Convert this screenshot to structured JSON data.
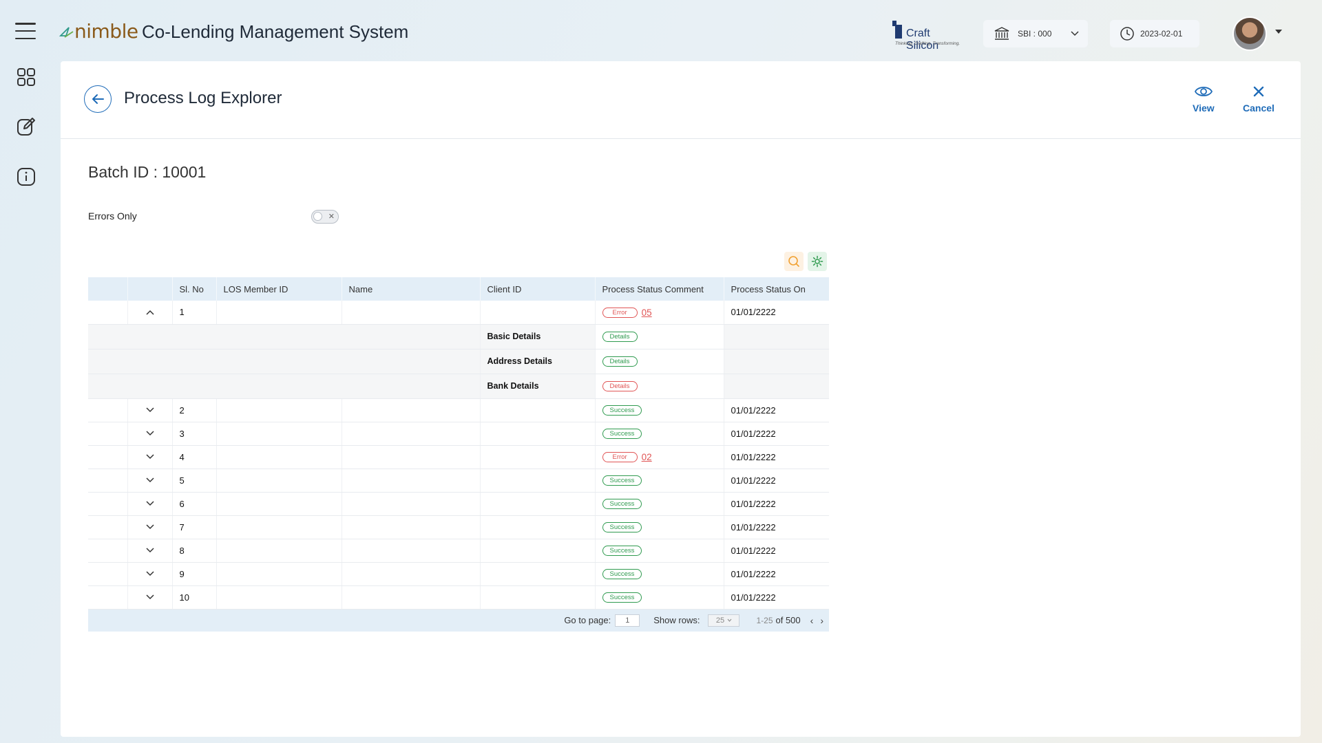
{
  "app": {
    "logo": "nimble",
    "title": "Co-Lending Management System",
    "partner_name": "Craft Silicon",
    "partner_tagline": "Thinking. Crafting. Transforming.",
    "bank_selector": "SBI : 000",
    "date": "2023-02-01"
  },
  "page": {
    "title": "Process Log Explorer",
    "view_label": "View",
    "cancel_label": "Cancel",
    "batch_label": "Batch ID : 10001",
    "errors_only_label": "Errors Only",
    "errors_only_on": false
  },
  "table": {
    "columns": [
      "",
      "",
      "Sl. No",
      "LOS Member ID",
      "Name",
      "Client ID",
      "Process Status Comment",
      "Process Status On"
    ],
    "rows": [
      {
        "sl": "1",
        "status": "Error",
        "code": "05",
        "date": "01/01/2222",
        "expanded": true
      },
      {
        "sl": "2",
        "status": "Success",
        "code": "",
        "date": "01/01/2222",
        "expanded": false
      },
      {
        "sl": "3",
        "status": "Success",
        "code": "",
        "date": "01/01/2222",
        "expanded": false
      },
      {
        "sl": "4",
        "status": "Error",
        "code": "02",
        "date": "01/01/2222",
        "expanded": false
      },
      {
        "sl": "5",
        "status": "Success",
        "code": "",
        "date": "01/01/2222",
        "expanded": false
      },
      {
        "sl": "6",
        "status": "Success",
        "code": "",
        "date": "01/01/2222",
        "expanded": false
      },
      {
        "sl": "7",
        "status": "Success",
        "code": "",
        "date": "01/01/2222",
        "expanded": false
      },
      {
        "sl": "8",
        "status": "Success",
        "code": "",
        "date": "01/01/2222",
        "expanded": false
      },
      {
        "sl": "9",
        "status": "Success",
        "code": "",
        "date": "01/01/2222",
        "expanded": false
      },
      {
        "sl": "10",
        "status": "Success",
        "code": "",
        "date": "01/01/2222",
        "expanded": false
      }
    ],
    "sub_rows": [
      {
        "label": "Basic Details",
        "badge": "Details",
        "state": "ok"
      },
      {
        "label": "Address Details",
        "badge": "Details",
        "state": "ok"
      },
      {
        "label": "Bank Details",
        "badge": "Details",
        "state": "error"
      }
    ]
  },
  "pager": {
    "goto_label": "Go to page:",
    "goto_value": "1",
    "rows_label": "Show rows:",
    "rows_value": "25",
    "range": "1-25",
    "total": "of 500"
  },
  "colors": {
    "primary": "#1e6bb8",
    "success": "#2e9a4e",
    "error": "#e05454",
    "header_bg": "#e3eef7"
  }
}
